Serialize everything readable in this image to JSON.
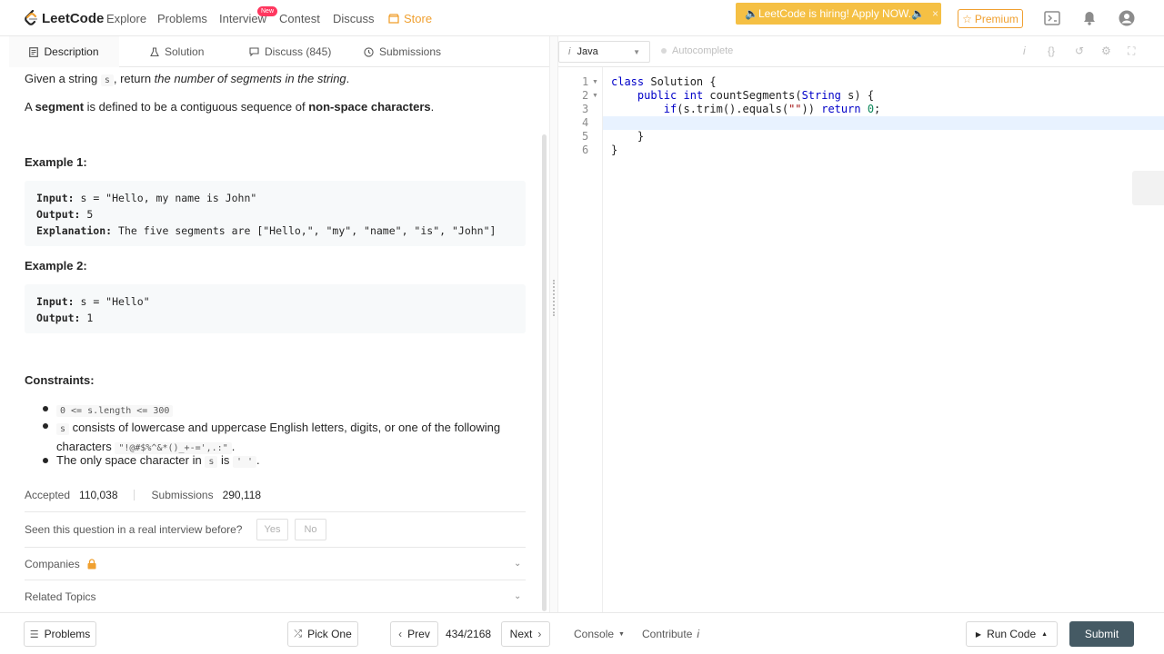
{
  "nav": {
    "logo_text": "LeetCode",
    "items": [
      "Explore",
      "Problems",
      "Interview",
      "Contest",
      "Discuss"
    ],
    "interview_badge": "New",
    "store": "Store",
    "hiring_banner": "🔈LeetCode is hiring! Apply NOW.🔈",
    "hiring_close": "×",
    "premium": "Premium"
  },
  "tabs": {
    "description": "Description",
    "solution": "Solution",
    "discuss": "Discuss (845)",
    "submissions": "Submissions"
  },
  "problem": {
    "intro_1": "Given a string ",
    "intro_code": "s",
    "intro_2": ", return ",
    "intro_em": "the number of segments in the string",
    "intro_3": ".",
    "def_1": "A ",
    "def_b1": "segment",
    "def_2": " is defined to be a contiguous sequence of ",
    "def_b2": "non-space characters",
    "def_3": ".",
    "example1_title": "Example 1:",
    "example1": {
      "input_label": "Input:",
      "input": " s = \"Hello, my name is John\"",
      "output_label": "Output:",
      "output": " 5",
      "expl_label": "Explanation:",
      "expl": " The five segments are [\"Hello,\", \"my\", \"name\", \"is\", \"John\"]"
    },
    "example2_title": "Example 2:",
    "example2": {
      "input_label": "Input:",
      "input": " s = \"Hello\"",
      "output_label": "Output:",
      "output": " 1"
    },
    "constraints_title": "Constraints:",
    "c1_code": "0 <= s.length <= 300",
    "c2_code": "s",
    "c2_text_1": " consists of lowercase and uppercase English letters, digits, or one of the following",
    "c2_text_2": "characters ",
    "c2_code2": "\"!@#$%^&*()_+-=',.:\"",
    "c2_text_3": ".",
    "c3_text_1": "The only space character in ",
    "c3_code": "s",
    "c3_text_2": " is ",
    "c3_code2": "' '",
    "c3_text_3": "."
  },
  "stats": {
    "accepted_label": "Accepted",
    "accepted": "110,038",
    "submissions_label": "Submissions",
    "submissions": "290,118"
  },
  "interview_q": {
    "question": "Seen this question in a real interview before?",
    "yes": "Yes",
    "no": "No"
  },
  "sections": {
    "companies": "Companies",
    "related": "Related Topics"
  },
  "editor": {
    "language": "Java",
    "autocomplete": "Autocomplete",
    "line_numbers": [
      "1",
      "2",
      "3",
      "4",
      "5",
      "6"
    ],
    "lines": [
      "class Solution {",
      "    public int countSegments(String s) {",
      "        if(s.trim().equals(\"\")) return 0;",
      "",
      "    }",
      "}"
    ]
  },
  "bottom": {
    "problems": "Problems",
    "pick_one": "Pick One",
    "prev": "Prev",
    "page": "434/2168",
    "next": "Next",
    "console": "Console",
    "contribute": "Contribute",
    "run_code": "Run Code",
    "submit": "Submit"
  },
  "colors": {
    "brand_orange": "#f0a030",
    "hiring_bg": "#f5c044",
    "submit_bg": "#455a64",
    "active_line": "#e8f2ff"
  }
}
